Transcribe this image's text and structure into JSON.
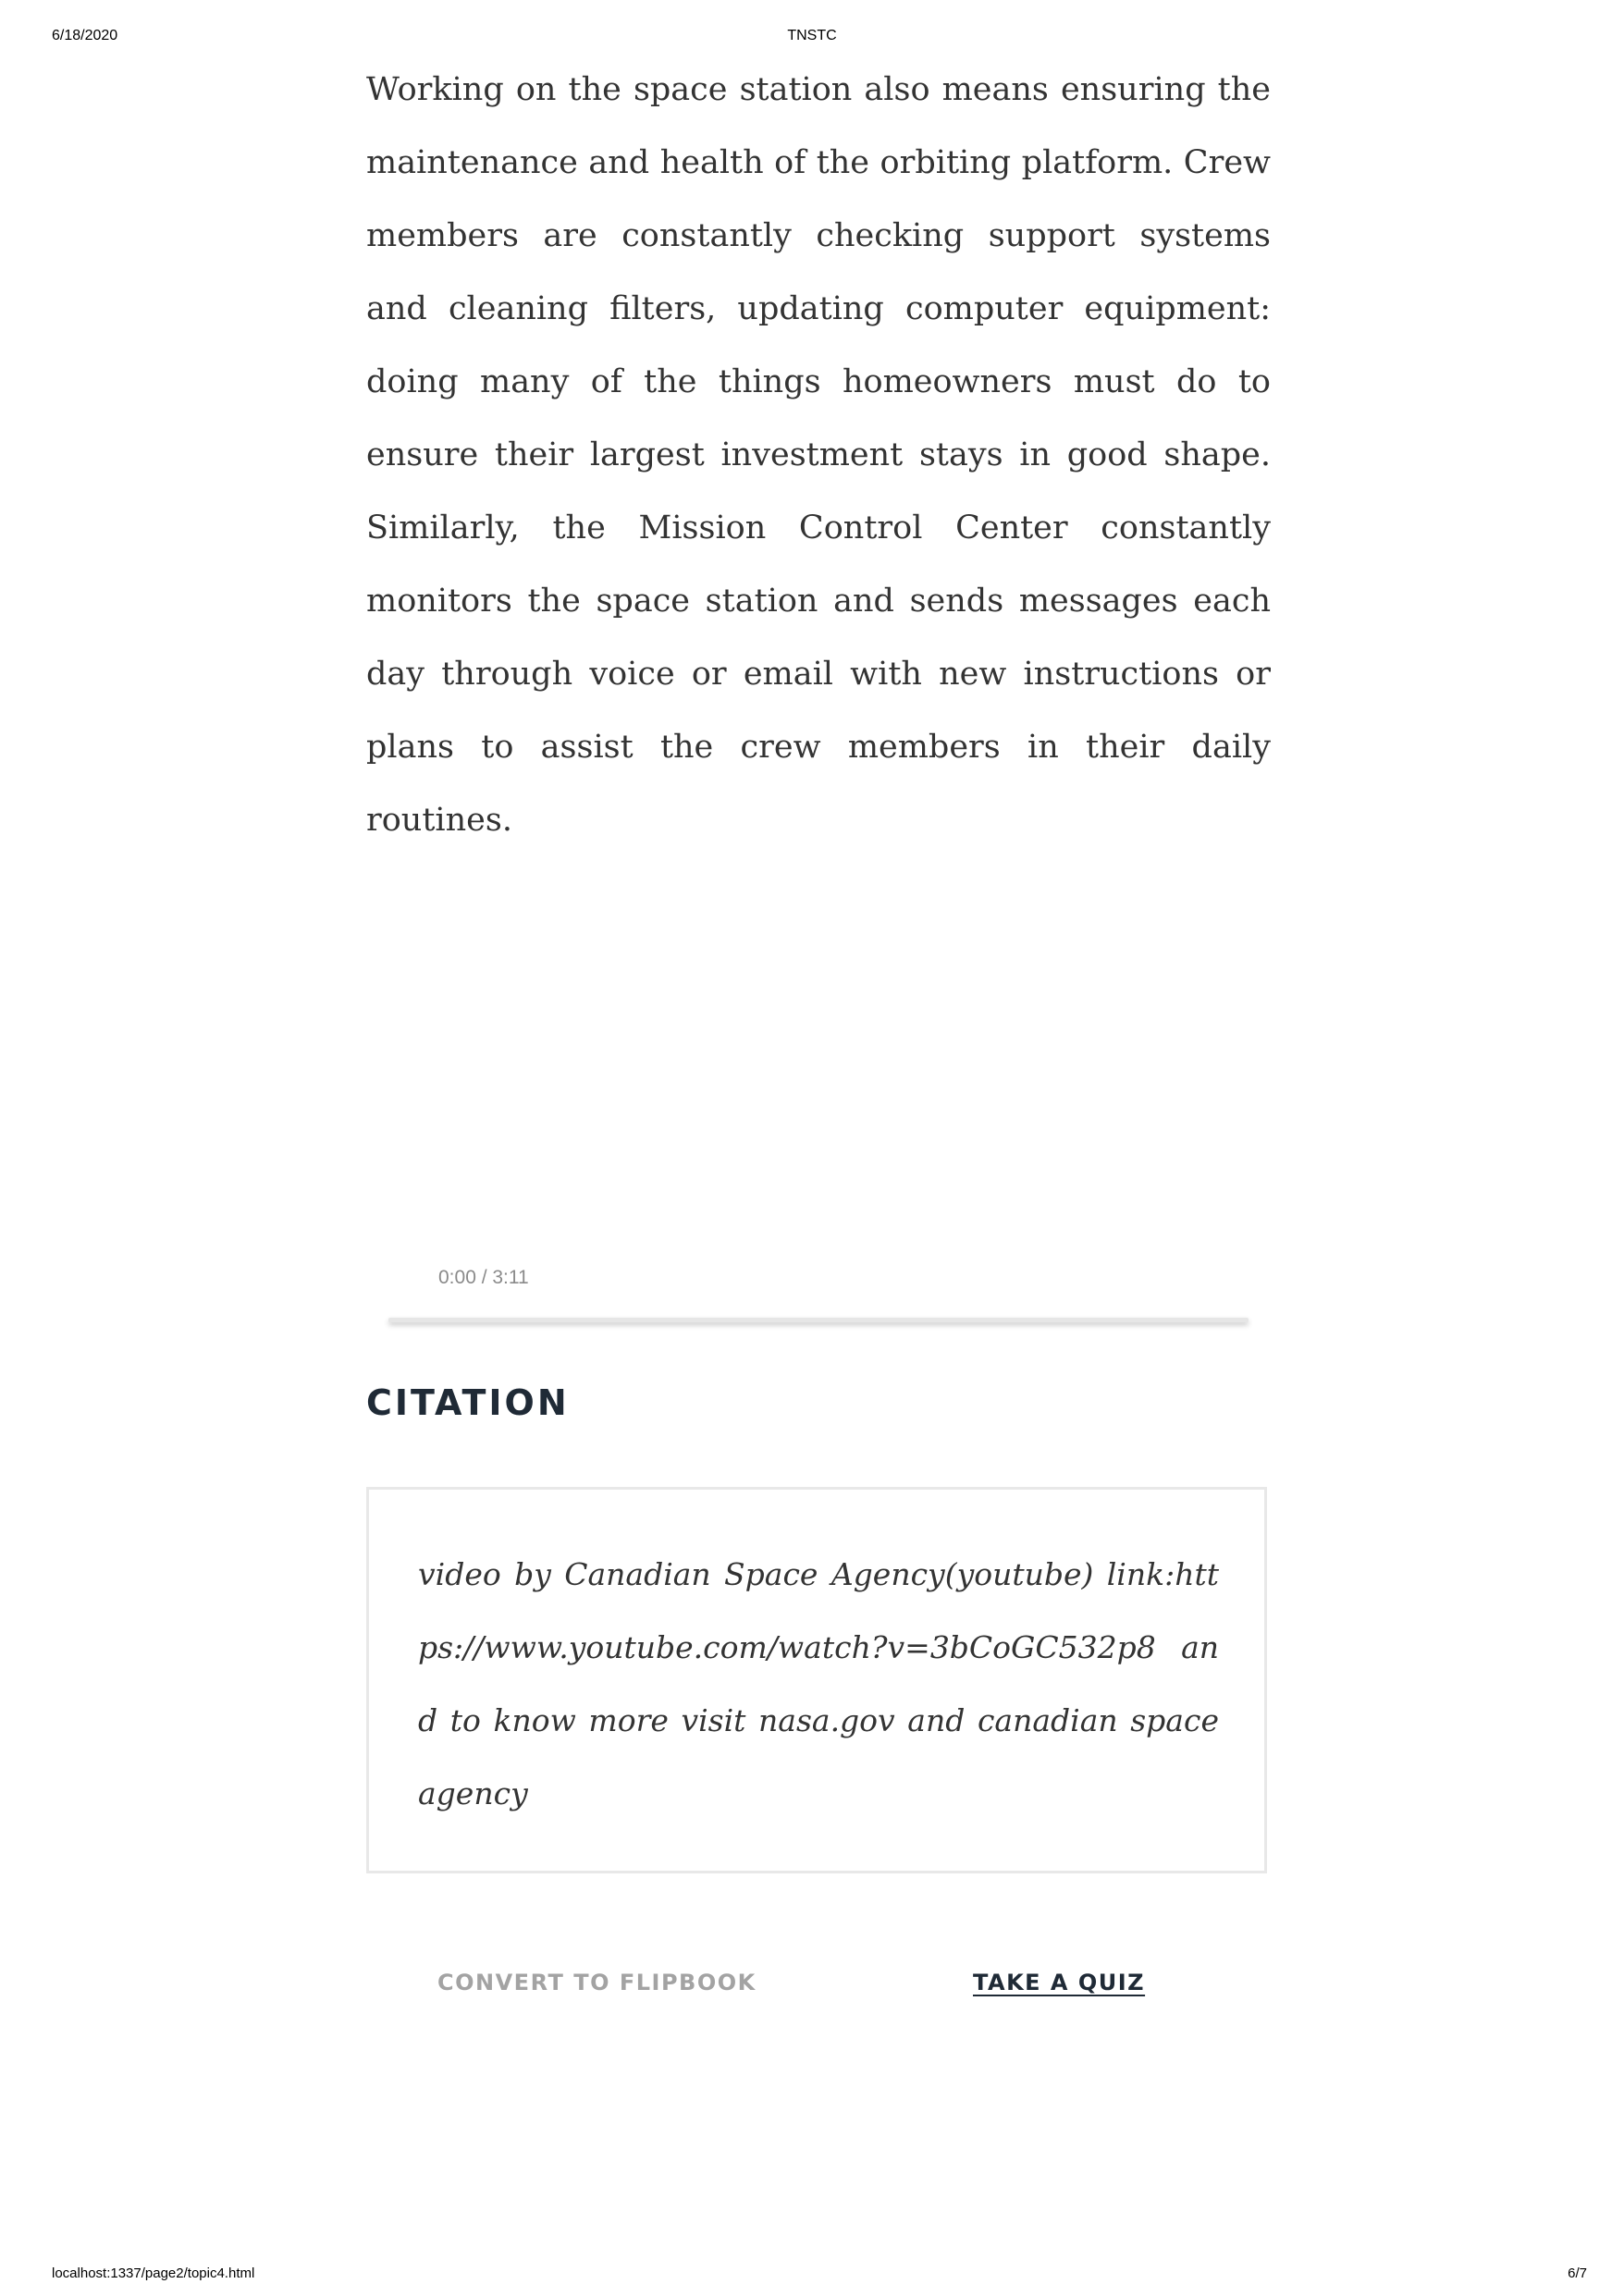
{
  "print_header": {
    "date": "6/18/2020",
    "title": "TNSTC"
  },
  "article": {
    "paragraph": "Working on the space station also means ensuring the maintenance and health of the orbiting platform. Crew members are constantly checking support systems and cleaning filters, updating computer equipment: doing many of the things homeowners must do to ensure their largest investment stays in good shape. Similarly, the Mission Control Center constantly monitors the space station and sends messages each day through voice or email with new instructions or plans to assist the crew members in their daily routines."
  },
  "video": {
    "time_display": "0:00 / 3:11",
    "progress_fraction": 0
  },
  "citation": {
    "heading": "CITATION",
    "text": "video by Canadian Space Agency(youtube) link:https://www.youtube.com/watch?v=3bCoGC532p8 and to know more visit nasa.gov and canadian space agency"
  },
  "actions": {
    "flipbook_label": "CONVERT TO FLIPBOOK",
    "quiz_label": "TAKE A QUIZ"
  },
  "print_footer": {
    "url": "localhost:1337/page2/topic4.html",
    "page": "6/7"
  }
}
